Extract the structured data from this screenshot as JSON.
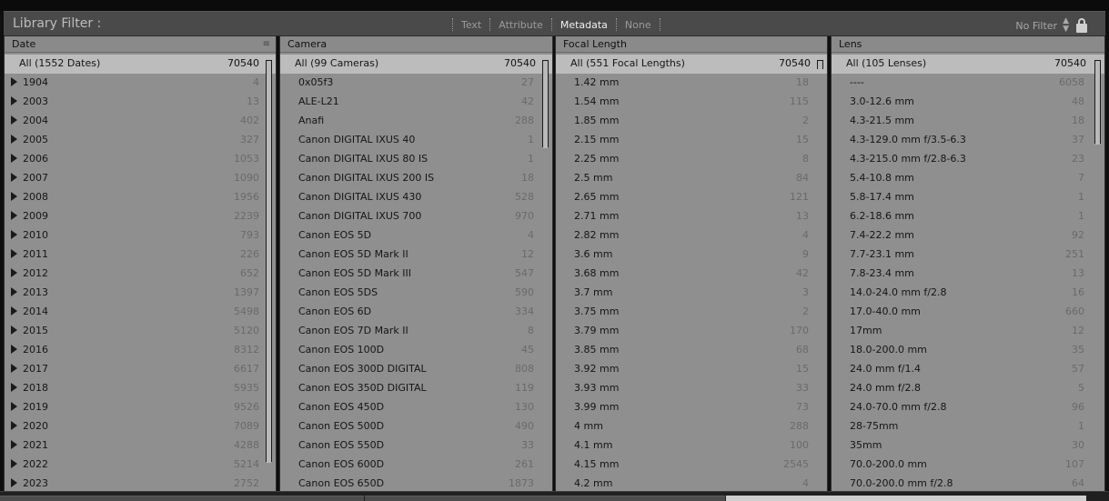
{
  "filter_bar": {
    "title": "Library Filter :",
    "modes": [
      {
        "label": "Text",
        "active": false
      },
      {
        "label": "Attribute",
        "active": false
      },
      {
        "label": "Metadata",
        "active": true
      },
      {
        "label": "None",
        "active": false
      }
    ],
    "preset_label": "No Filter",
    "icons": {
      "preset_stepper": "updown-icon",
      "lock": "lock-icon"
    }
  },
  "columns": [
    {
      "header": "Date",
      "all_row": {
        "label": "All (1552 Dates)",
        "count": "70540"
      },
      "rows": [
        {
          "label": "1904",
          "count": "4"
        },
        {
          "label": "2003",
          "count": "13"
        },
        {
          "label": "2004",
          "count": "402"
        },
        {
          "label": "2005",
          "count": "327"
        },
        {
          "label": "2006",
          "count": "1053"
        },
        {
          "label": "2007",
          "count": "1090"
        },
        {
          "label": "2008",
          "count": "1956"
        },
        {
          "label": "2009",
          "count": "2239"
        },
        {
          "label": "2010",
          "count": "793"
        },
        {
          "label": "2011",
          "count": "226"
        },
        {
          "label": "2012",
          "count": "652"
        },
        {
          "label": "2013",
          "count": "1397"
        },
        {
          "label": "2014",
          "count": "5498"
        },
        {
          "label": "2015",
          "count": "5120"
        },
        {
          "label": "2016",
          "count": "8312"
        },
        {
          "label": "2017",
          "count": "6617"
        },
        {
          "label": "2018",
          "count": "5935"
        },
        {
          "label": "2019",
          "count": "9526"
        },
        {
          "label": "2020",
          "count": "7089"
        },
        {
          "label": "2021",
          "count": "4288"
        },
        {
          "label": "2022",
          "count": "5214"
        },
        {
          "label": "2023",
          "count": "2752"
        }
      ]
    },
    {
      "header": "Camera",
      "all_row": {
        "label": "All (99 Cameras)",
        "count": "70540"
      },
      "rows": [
        {
          "label": "0x05f3",
          "count": "27"
        },
        {
          "label": "ALE-L21",
          "count": "42"
        },
        {
          "label": "Anafi",
          "count": "288"
        },
        {
          "label": "Canon DIGITAL IXUS 40",
          "count": "1"
        },
        {
          "label": "Canon DIGITAL IXUS 80 IS",
          "count": "1"
        },
        {
          "label": "Canon DIGITAL IXUS 200 IS",
          "count": "18"
        },
        {
          "label": "Canon DIGITAL IXUS 430",
          "count": "528"
        },
        {
          "label": "Canon DIGITAL IXUS 700",
          "count": "970"
        },
        {
          "label": "Canon EOS 5D",
          "count": "4"
        },
        {
          "label": "Canon EOS 5D Mark II",
          "count": "12"
        },
        {
          "label": "Canon EOS 5D Mark III",
          "count": "547"
        },
        {
          "label": "Canon EOS 5DS",
          "count": "590"
        },
        {
          "label": "Canon EOS 6D",
          "count": "334"
        },
        {
          "label": "Canon EOS 7D Mark II",
          "count": "8"
        },
        {
          "label": "Canon EOS 100D",
          "count": "45"
        },
        {
          "label": "Canon EOS 300D DIGITAL",
          "count": "808"
        },
        {
          "label": "Canon EOS 350D DIGITAL",
          "count": "119"
        },
        {
          "label": "Canon EOS 450D",
          "count": "130"
        },
        {
          "label": "Canon EOS 500D",
          "count": "490"
        },
        {
          "label": "Canon EOS 550D",
          "count": "33"
        },
        {
          "label": "Canon EOS 600D",
          "count": "261"
        },
        {
          "label": "Canon EOS 650D",
          "count": "1873"
        }
      ]
    },
    {
      "header": "Focal Length",
      "all_row": {
        "label": "All (551 Focal Lengths)",
        "count": "70540"
      },
      "rows": [
        {
          "label": "1.42 mm",
          "count": "18"
        },
        {
          "label": "1.54 mm",
          "count": "115"
        },
        {
          "label": "1.85 mm",
          "count": "2"
        },
        {
          "label": "2.15 mm",
          "count": "15"
        },
        {
          "label": "2.25 mm",
          "count": "8"
        },
        {
          "label": "2.5 mm",
          "count": "84"
        },
        {
          "label": "2.65 mm",
          "count": "121"
        },
        {
          "label": "2.71 mm",
          "count": "13"
        },
        {
          "label": "2.82 mm",
          "count": "4"
        },
        {
          "label": "3.6 mm",
          "count": "9"
        },
        {
          "label": "3.68 mm",
          "count": "42"
        },
        {
          "label": "3.7 mm",
          "count": "3"
        },
        {
          "label": "3.75 mm",
          "count": "2"
        },
        {
          "label": "3.79 mm",
          "count": "170"
        },
        {
          "label": "3.85 mm",
          "count": "68"
        },
        {
          "label": "3.92 mm",
          "count": "15"
        },
        {
          "label": "3.93 mm",
          "count": "33"
        },
        {
          "label": "3.99 mm",
          "count": "73"
        },
        {
          "label": "4 mm",
          "count": "288"
        },
        {
          "label": "4.1 mm",
          "count": "100"
        },
        {
          "label": "4.15 mm",
          "count": "2545"
        },
        {
          "label": "4.2 mm",
          "count": "4"
        }
      ]
    },
    {
      "header": "Lens",
      "all_row": {
        "label": "All (105 Lenses)",
        "count": "70540"
      },
      "rows": [
        {
          "label": "----",
          "count": "6058"
        },
        {
          "label": "3.0-12.6 mm",
          "count": "48"
        },
        {
          "label": "4.3-21.5 mm",
          "count": "18"
        },
        {
          "label": "4.3-129.0 mm f/3.5-6.3",
          "count": "37"
        },
        {
          "label": "4.3-215.0 mm f/2.8-6.3",
          "count": "23"
        },
        {
          "label": "5.4-10.8 mm",
          "count": "7"
        },
        {
          "label": "5.8-17.4 mm",
          "count": "1"
        },
        {
          "label": "6.2-18.6 mm",
          "count": "1"
        },
        {
          "label": "7.4-22.2 mm",
          "count": "92"
        },
        {
          "label": "7.7-23.1 mm",
          "count": "251"
        },
        {
          "label": "7.8-23.4 mm",
          "count": "13"
        },
        {
          "label": "14.0-24.0 mm f/2.8",
          "count": "16"
        },
        {
          "label": "17.0-40.0 mm",
          "count": "660"
        },
        {
          "label": "17mm",
          "count": "12"
        },
        {
          "label": "18.0-200.0 mm",
          "count": "35"
        },
        {
          "label": "24.0 mm f/1.4",
          "count": "57"
        },
        {
          "label": "24.0 mm f/2.8",
          "count": "5"
        },
        {
          "label": "24.0-70.0 mm f/2.8",
          "count": "96"
        },
        {
          "label": "28-75mm",
          "count": "1"
        },
        {
          "label": "35mm",
          "count": "30"
        },
        {
          "label": "70.0-200.0 mm",
          "count": "107"
        },
        {
          "label": "70.0-200.0 mm f/2.8",
          "count": "64"
        }
      ]
    }
  ],
  "icons": {
    "expand": "expand-triangle-icon",
    "column_menu": "column-menu-icon"
  }
}
